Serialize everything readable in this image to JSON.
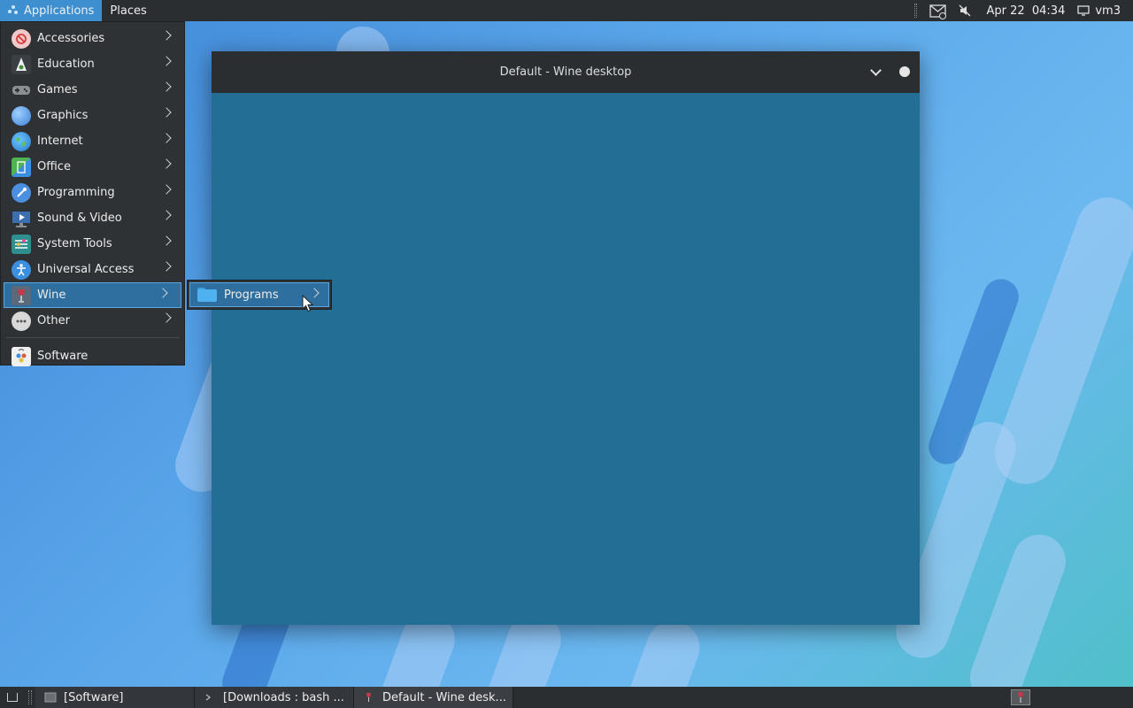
{
  "top_panel": {
    "applications_label": "Applications",
    "places_label": "Places",
    "clock": "Apr 22  04:34",
    "hostname": "vm3"
  },
  "app_menu": {
    "items": [
      {
        "label": "Accessories",
        "icon": "accessories-icon"
      },
      {
        "label": "Education",
        "icon": "education-icon"
      },
      {
        "label": "Games",
        "icon": "games-icon"
      },
      {
        "label": "Graphics",
        "icon": "graphics-icon"
      },
      {
        "label": "Internet",
        "icon": "internet-icon"
      },
      {
        "label": "Office",
        "icon": "office-icon"
      },
      {
        "label": "Programming",
        "icon": "programming-icon"
      },
      {
        "label": "Sound & Video",
        "icon": "sound-video-icon"
      },
      {
        "label": "System Tools",
        "icon": "system-tools-icon"
      },
      {
        "label": "Universal Access",
        "icon": "universal-access-icon"
      },
      {
        "label": "Wine",
        "icon": "wine-icon"
      },
      {
        "label": "Other",
        "icon": "other-icon"
      }
    ],
    "selected": "Wine",
    "software_label": "Software"
  },
  "submenu": {
    "programs_label": "Programs"
  },
  "wine_window": {
    "title": "Default - Wine desktop"
  },
  "taskbar": {
    "tasks": [
      {
        "label": "[Software]"
      },
      {
        "label": "[Downloads : bash ..."
      },
      {
        "label": "Default - Wine desk..."
      }
    ]
  },
  "colors": {
    "panel": "#2b2e31",
    "menu_bg": "#2f3234",
    "selection": "#2f6f9f",
    "accent": "#3d8fd0",
    "wine_desktop": "#236e95"
  }
}
